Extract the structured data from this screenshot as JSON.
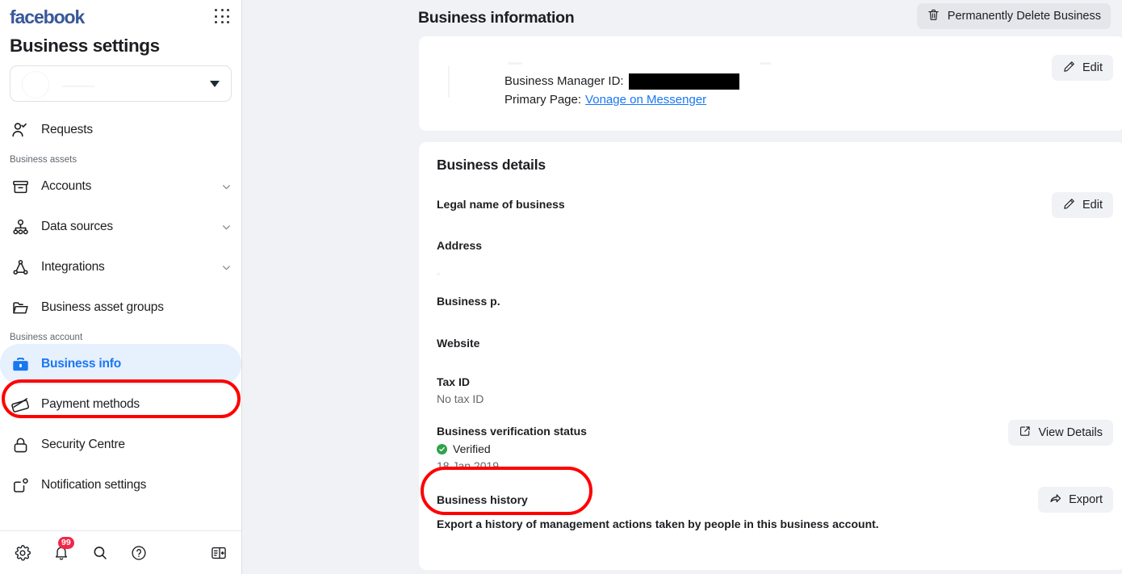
{
  "sidebar": {
    "brand": "facebook",
    "apps_icon": "grid-apps-icon",
    "page_title": "Business settings",
    "business_selector": {
      "value": "",
      "icon": "chevron-down-icon"
    },
    "requests": {
      "label": "Requests",
      "icon": "person-check-icon"
    },
    "sections": [
      {
        "label": "Business assets",
        "items": [
          {
            "label": "Accounts",
            "icon": "archive-box-icon",
            "expandable": true
          },
          {
            "label": "Data sources",
            "icon": "data-sources-icon",
            "expandable": true
          },
          {
            "label": "Integrations",
            "icon": "integrations-icon",
            "expandable": true
          },
          {
            "label": "Business asset groups",
            "icon": "folder-icon",
            "expandable": false
          }
        ]
      },
      {
        "label": "Business account",
        "items": [
          {
            "label": "Business info",
            "icon": "briefcase-icon",
            "expandable": false,
            "active": true
          },
          {
            "label": "Payment methods",
            "icon": "credit-card-icon",
            "expandable": false
          },
          {
            "label": "Security Centre",
            "icon": "lock-icon",
            "expandable": false
          },
          {
            "label": "Notification settings",
            "icon": "notification-icon",
            "expandable": false
          }
        ]
      }
    ],
    "toolbar": {
      "settings": {
        "label": "Settings",
        "icon": "gear-icon"
      },
      "notifications": {
        "label": "Notifications",
        "icon": "bell-icon",
        "badge": "99"
      },
      "search": {
        "label": "Search",
        "icon": "search-icon"
      },
      "help": {
        "label": "Help",
        "icon": "question-circle-icon"
      },
      "collapse": {
        "label": "Collapse panel",
        "icon": "panel-toggle-icon"
      }
    }
  },
  "main": {
    "title": "Business information",
    "delete_button": {
      "label": "Permanently Delete Business",
      "icon": "trash-icon"
    },
    "info_card": {
      "business_manager_id_label": "Business Manager ID:",
      "business_manager_id_value": "",
      "primary_page_label": "Primary Page:",
      "primary_page_value": "Vonage on Messenger",
      "edit_button": {
        "label": "Edit",
        "icon": "pencil-icon"
      }
    },
    "details_card": {
      "title": "Business details",
      "edit_button": {
        "label": "Edit",
        "icon": "pencil-icon"
      },
      "fields": [
        {
          "label": "Legal name of business",
          "value": ""
        },
        {
          "label": "Address",
          "value": ""
        },
        {
          "label": "Business p.",
          "value": ""
        },
        {
          "label": "Website",
          "value": ""
        },
        {
          "label": "Tax ID",
          "value": "No tax ID"
        }
      ],
      "verification": {
        "label": "Business verification status",
        "status": "Verified",
        "date": "18 Jan 2019",
        "view_details_button": {
          "label": "View Details",
          "icon": "external-link-icon"
        }
      },
      "history": {
        "label": "Business history",
        "description": "Export a history of management actions taken by people in this business account.",
        "export_button": {
          "label": "Export",
          "icon": "share-arrow-icon"
        }
      }
    }
  },
  "colors": {
    "brand_blue": "#385898",
    "link_blue": "#1877f2",
    "active_bg": "#e7f0fd",
    "verified_green": "#31a24c",
    "badge_red": "#f02849",
    "annotation_red": "#ff0000",
    "content_bg": "#f0f2f5"
  }
}
